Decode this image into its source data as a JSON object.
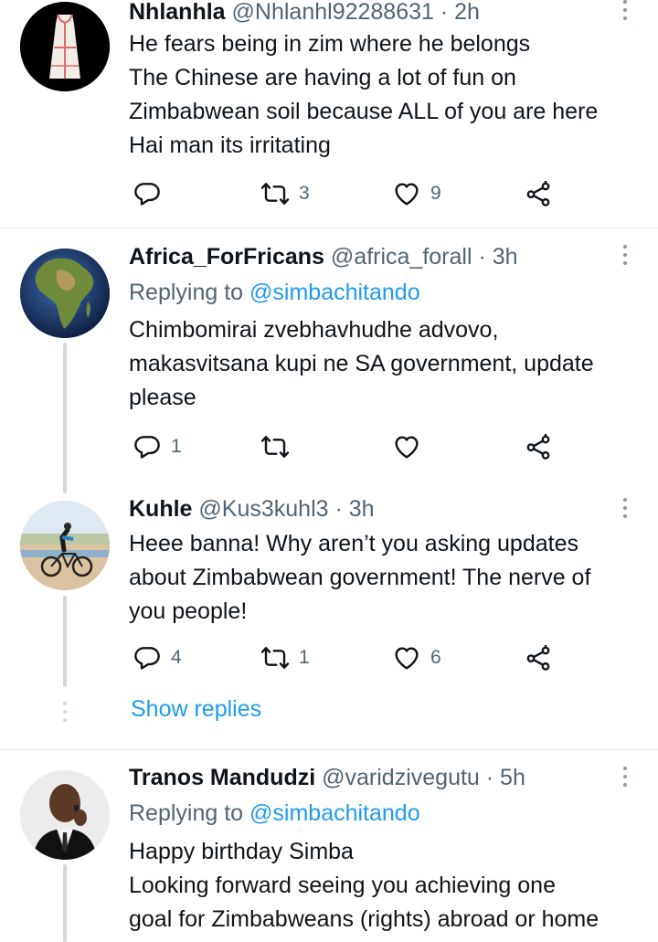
{
  "tweets": [
    {
      "name": "Nhlanhla",
      "handle": "@Nhlanhl92288631 · 2h",
      "lines": [
        "He fears being in zim where he belongs",
        "The Chinese are having a lot of fun on",
        "Zimbabwean soil because ALL of you are here",
        "Hai man its irritating"
      ],
      "reply_count": "",
      "retweet_count": "3",
      "like_count": "9"
    },
    {
      "name": "Africa_ForFricans",
      "handle": "@africa_forall · 3h",
      "replying_prefix": "Replying to",
      "replying_to": "@simbachitando",
      "lines": [
        "Chimbomirai zvebhavhudhe advovo,",
        "makasvitsana kupi ne SA government, update",
        "please"
      ],
      "reply_count": "1",
      "retweet_count": "",
      "like_count": ""
    },
    {
      "name": "Kuhle",
      "handle": "@Kus3kuhl3 · 3h",
      "lines": [
        "Heee banna! Why aren’t you asking updates",
        "about Zimbabwean government! The nerve of",
        "you people!"
      ],
      "reply_count": "4",
      "retweet_count": "1",
      "like_count": "6"
    },
    {
      "name": "Tranos Mandudzi",
      "handle": "@varidzivegutu · 5h",
      "replying_prefix": "Replying to",
      "replying_to": "@simbachitando",
      "lines": [
        "Happy birthday Simba",
        "Looking forward  seeing you achieving one",
        "goal for Zimbabweans (rights) abroad or home"
      ]
    }
  ],
  "show_replies": "Show replies",
  "icons": [
    "reply-icon",
    "retweet-icon",
    "like-icon",
    "share-icon",
    "more-icon"
  ],
  "colors": {
    "link": "#1d9bf0",
    "muted": "#536471",
    "divider": "#e6ecf0"
  }
}
